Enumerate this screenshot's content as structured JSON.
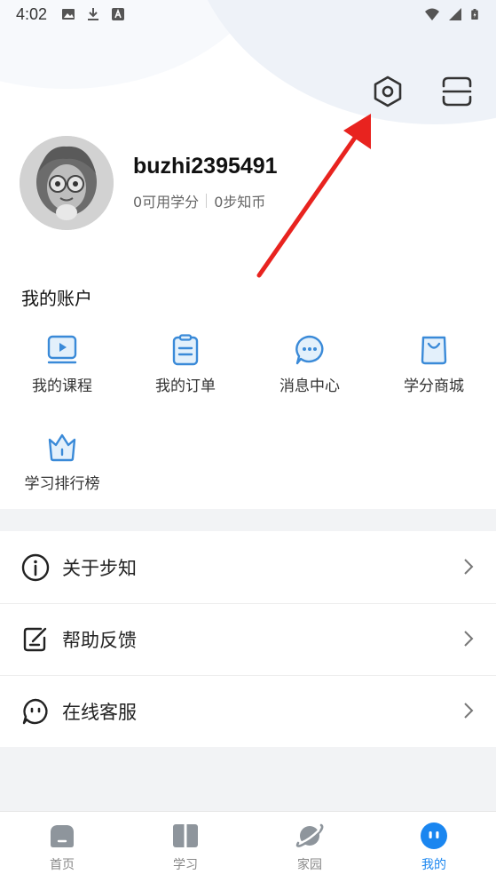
{
  "status_bar": {
    "time": "4:02",
    "left_icons": [
      "image-icon",
      "download-icon",
      "text-a-icon"
    ],
    "right_icons": [
      "wifi-icon",
      "signal-icon",
      "battery-icon"
    ]
  },
  "top_actions": {
    "settings_icon": "settings-hexagon-icon",
    "scan_icon": "scan-icon"
  },
  "profile": {
    "username": "buzhi2395491",
    "points": "0可用学分",
    "coins": "0步知币"
  },
  "account": {
    "title": "我的账户",
    "items": [
      {
        "label": "我的课程",
        "icon": "course-icon"
      },
      {
        "label": "我的订单",
        "icon": "order-icon"
      },
      {
        "label": "消息中心",
        "icon": "message-icon"
      },
      {
        "label": "学分商城",
        "icon": "shop-icon"
      },
      {
        "label": "学习排行榜",
        "icon": "crown-icon"
      }
    ]
  },
  "menu": {
    "items": [
      {
        "label": "关于步知",
        "icon": "info-icon"
      },
      {
        "label": "帮助反馈",
        "icon": "feedback-icon"
      },
      {
        "label": "在线客服",
        "icon": "chat-icon"
      }
    ]
  },
  "bottom_nav": {
    "items": [
      {
        "label": "首页",
        "icon": "home-icon"
      },
      {
        "label": "学习",
        "icon": "book-icon"
      },
      {
        "label": "家园",
        "icon": "planet-icon"
      },
      {
        "label": "我的",
        "icon": "me-icon"
      }
    ],
    "active_index": 3
  },
  "colors": {
    "accent": "#1a86f0",
    "icon_blue": "#3a8ad8",
    "icon_fill": "#e3f0fb",
    "annotation_red": "#e8231f"
  }
}
